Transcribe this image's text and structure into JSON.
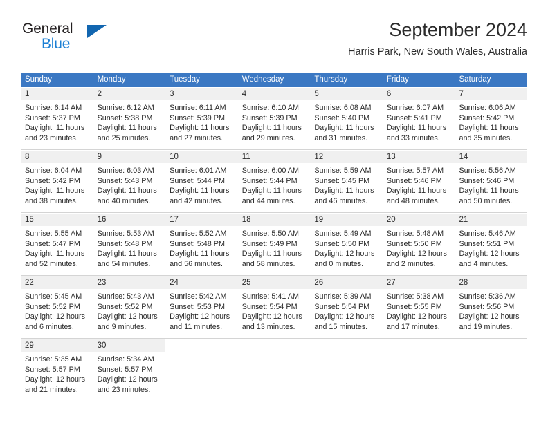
{
  "brand": {
    "name_part1": "General",
    "name_part2": "Blue",
    "triangle_color": "#1266b0",
    "blue_color": "#1b7fd4"
  },
  "header": {
    "title": "September 2024",
    "subtitle": "Harris Park, New South Wales, Australia"
  },
  "theme": {
    "header_bg": "#3b78c3",
    "header_text": "#ffffff",
    "daynum_bg": "#f0f0f0",
    "cell_bg": "#ffffff",
    "separator": "#d4d4d4",
    "text": "#2b2b2b"
  },
  "weekdays": [
    "Sunday",
    "Monday",
    "Tuesday",
    "Wednesday",
    "Thursday",
    "Friday",
    "Saturday"
  ],
  "labels": {
    "sunrise_prefix": "Sunrise:",
    "sunset_prefix": "Sunset:",
    "daylight_prefix": "Daylight:"
  },
  "weeks": [
    {
      "days": [
        {
          "num": "1",
          "sunrise": "Sunrise: 6:14 AM",
          "sunset": "Sunset: 5:37 PM",
          "daylight": "Daylight: 11 hours and 23 minutes."
        },
        {
          "num": "2",
          "sunrise": "Sunrise: 6:12 AM",
          "sunset": "Sunset: 5:38 PM",
          "daylight": "Daylight: 11 hours and 25 minutes."
        },
        {
          "num": "3",
          "sunrise": "Sunrise: 6:11 AM",
          "sunset": "Sunset: 5:39 PM",
          "daylight": "Daylight: 11 hours and 27 minutes."
        },
        {
          "num": "4",
          "sunrise": "Sunrise: 6:10 AM",
          "sunset": "Sunset: 5:39 PM",
          "daylight": "Daylight: 11 hours and 29 minutes."
        },
        {
          "num": "5",
          "sunrise": "Sunrise: 6:08 AM",
          "sunset": "Sunset: 5:40 PM",
          "daylight": "Daylight: 11 hours and 31 minutes."
        },
        {
          "num": "6",
          "sunrise": "Sunrise: 6:07 AM",
          "sunset": "Sunset: 5:41 PM",
          "daylight": "Daylight: 11 hours and 33 minutes."
        },
        {
          "num": "7",
          "sunrise": "Sunrise: 6:06 AM",
          "sunset": "Sunset: 5:42 PM",
          "daylight": "Daylight: 11 hours and 35 minutes."
        }
      ]
    },
    {
      "days": [
        {
          "num": "8",
          "sunrise": "Sunrise: 6:04 AM",
          "sunset": "Sunset: 5:42 PM",
          "daylight": "Daylight: 11 hours and 38 minutes."
        },
        {
          "num": "9",
          "sunrise": "Sunrise: 6:03 AM",
          "sunset": "Sunset: 5:43 PM",
          "daylight": "Daylight: 11 hours and 40 minutes."
        },
        {
          "num": "10",
          "sunrise": "Sunrise: 6:01 AM",
          "sunset": "Sunset: 5:44 PM",
          "daylight": "Daylight: 11 hours and 42 minutes."
        },
        {
          "num": "11",
          "sunrise": "Sunrise: 6:00 AM",
          "sunset": "Sunset: 5:44 PM",
          "daylight": "Daylight: 11 hours and 44 minutes."
        },
        {
          "num": "12",
          "sunrise": "Sunrise: 5:59 AM",
          "sunset": "Sunset: 5:45 PM",
          "daylight": "Daylight: 11 hours and 46 minutes."
        },
        {
          "num": "13",
          "sunrise": "Sunrise: 5:57 AM",
          "sunset": "Sunset: 5:46 PM",
          "daylight": "Daylight: 11 hours and 48 minutes."
        },
        {
          "num": "14",
          "sunrise": "Sunrise: 5:56 AM",
          "sunset": "Sunset: 5:46 PM",
          "daylight": "Daylight: 11 hours and 50 minutes."
        }
      ]
    },
    {
      "days": [
        {
          "num": "15",
          "sunrise": "Sunrise: 5:55 AM",
          "sunset": "Sunset: 5:47 PM",
          "daylight": "Daylight: 11 hours and 52 minutes."
        },
        {
          "num": "16",
          "sunrise": "Sunrise: 5:53 AM",
          "sunset": "Sunset: 5:48 PM",
          "daylight": "Daylight: 11 hours and 54 minutes."
        },
        {
          "num": "17",
          "sunrise": "Sunrise: 5:52 AM",
          "sunset": "Sunset: 5:48 PM",
          "daylight": "Daylight: 11 hours and 56 minutes."
        },
        {
          "num": "18",
          "sunrise": "Sunrise: 5:50 AM",
          "sunset": "Sunset: 5:49 PM",
          "daylight": "Daylight: 11 hours and 58 minutes."
        },
        {
          "num": "19",
          "sunrise": "Sunrise: 5:49 AM",
          "sunset": "Sunset: 5:50 PM",
          "daylight": "Daylight: 12 hours and 0 minutes."
        },
        {
          "num": "20",
          "sunrise": "Sunrise: 5:48 AM",
          "sunset": "Sunset: 5:50 PM",
          "daylight": "Daylight: 12 hours and 2 minutes."
        },
        {
          "num": "21",
          "sunrise": "Sunrise: 5:46 AM",
          "sunset": "Sunset: 5:51 PM",
          "daylight": "Daylight: 12 hours and 4 minutes."
        }
      ]
    },
    {
      "days": [
        {
          "num": "22",
          "sunrise": "Sunrise: 5:45 AM",
          "sunset": "Sunset: 5:52 PM",
          "daylight": "Daylight: 12 hours and 6 minutes."
        },
        {
          "num": "23",
          "sunrise": "Sunrise: 5:43 AM",
          "sunset": "Sunset: 5:52 PM",
          "daylight": "Daylight: 12 hours and 9 minutes."
        },
        {
          "num": "24",
          "sunrise": "Sunrise: 5:42 AM",
          "sunset": "Sunset: 5:53 PM",
          "daylight": "Daylight: 12 hours and 11 minutes."
        },
        {
          "num": "25",
          "sunrise": "Sunrise: 5:41 AM",
          "sunset": "Sunset: 5:54 PM",
          "daylight": "Daylight: 12 hours and 13 minutes."
        },
        {
          "num": "26",
          "sunrise": "Sunrise: 5:39 AM",
          "sunset": "Sunset: 5:54 PM",
          "daylight": "Daylight: 12 hours and 15 minutes."
        },
        {
          "num": "27",
          "sunrise": "Sunrise: 5:38 AM",
          "sunset": "Sunset: 5:55 PM",
          "daylight": "Daylight: 12 hours and 17 minutes."
        },
        {
          "num": "28",
          "sunrise": "Sunrise: 5:36 AM",
          "sunset": "Sunset: 5:56 PM",
          "daylight": "Daylight: 12 hours and 19 minutes."
        }
      ]
    },
    {
      "days": [
        {
          "num": "29",
          "sunrise": "Sunrise: 5:35 AM",
          "sunset": "Sunset: 5:57 PM",
          "daylight": "Daylight: 12 hours and 21 minutes."
        },
        {
          "num": "30",
          "sunrise": "Sunrise: 5:34 AM",
          "sunset": "Sunset: 5:57 PM",
          "daylight": "Daylight: 12 hours and 23 minutes."
        },
        {
          "num": "",
          "sunrise": "",
          "sunset": "",
          "daylight": ""
        },
        {
          "num": "",
          "sunrise": "",
          "sunset": "",
          "daylight": ""
        },
        {
          "num": "",
          "sunrise": "",
          "sunset": "",
          "daylight": ""
        },
        {
          "num": "",
          "sunrise": "",
          "sunset": "",
          "daylight": ""
        },
        {
          "num": "",
          "sunrise": "",
          "sunset": "",
          "daylight": ""
        }
      ]
    }
  ]
}
